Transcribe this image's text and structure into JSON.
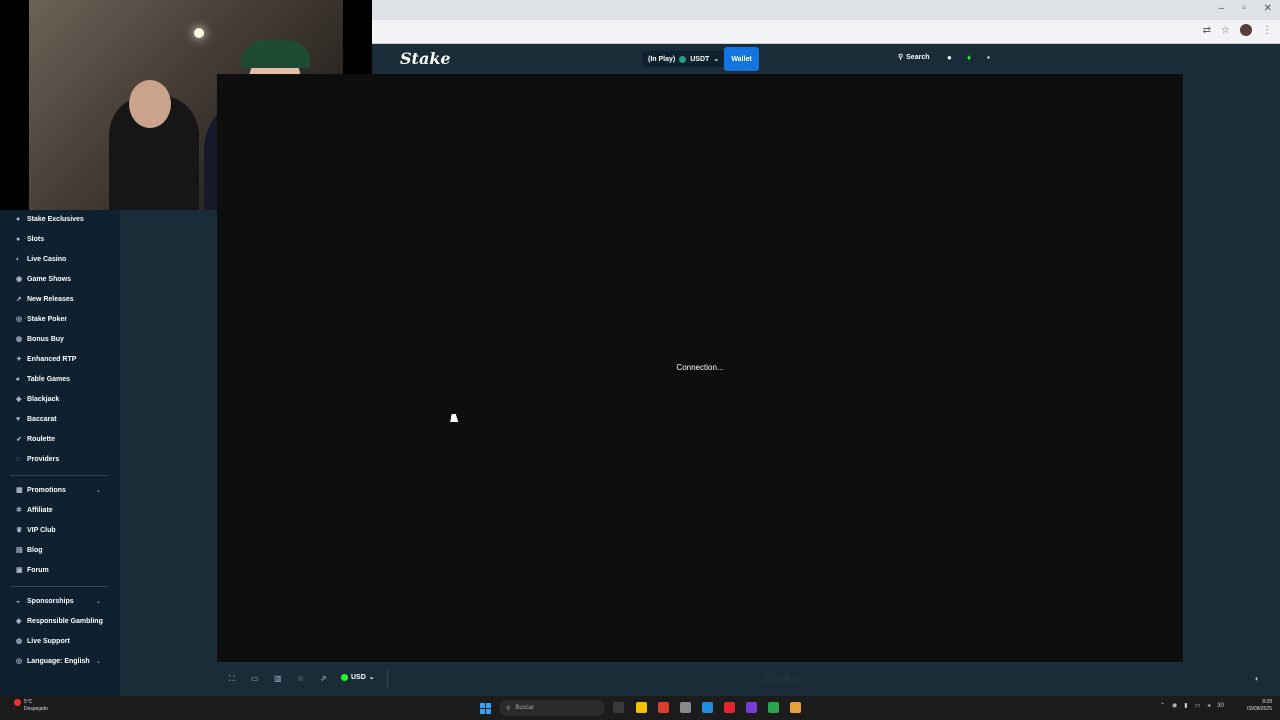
{
  "browser": {
    "window_controls": [
      "–",
      "▫",
      "✕"
    ],
    "address_icons": [
      "translate-icon",
      "star-icon",
      "profile-avatar",
      "menu-icon"
    ]
  },
  "header": {
    "logo": "Stake",
    "balance_label": "(In Play)",
    "balance_currency": "USDT",
    "wallet_label": "Wallet",
    "search_label": "Search"
  },
  "sidebar": {
    "casino_items": [
      {
        "label": "Stake Exclusives",
        "icon": "●"
      },
      {
        "label": "Slots",
        "icon": "●"
      },
      {
        "label": "Live Casino",
        "icon": "◐"
      },
      {
        "label": "Game Shows",
        "icon": "◉"
      },
      {
        "label": "New Releases",
        "icon": "➚"
      },
      {
        "label": "Stake Poker",
        "icon": "◎"
      },
      {
        "label": "Bonus Buy",
        "icon": "◍"
      },
      {
        "label": "Enhanced RTP",
        "icon": "✦"
      },
      {
        "label": "Table Games",
        "icon": "♠"
      },
      {
        "label": "Blackjack",
        "icon": "◈"
      },
      {
        "label": "Baccarat",
        "icon": "♥"
      },
      {
        "label": "Roulette",
        "icon": "➶"
      },
      {
        "label": "Providers",
        "icon": "◌"
      }
    ],
    "other_items": [
      {
        "label": "Promotions",
        "icon": "▦",
        "chevron": true
      },
      {
        "label": "Affiliate",
        "icon": "✲",
        "chevron": false
      },
      {
        "label": "VIP Club",
        "icon": "♛",
        "chevron": false
      },
      {
        "label": "Blog",
        "icon": "▤",
        "chevron": false
      },
      {
        "label": "Forum",
        "icon": "▣",
        "chevron": false
      }
    ],
    "bottom_items": [
      {
        "label": "Sponsorships",
        "icon": "◒",
        "chevron": true
      },
      {
        "label": "Responsible Gambling",
        "icon": "◈",
        "chevron": false
      },
      {
        "label": "Live Support",
        "icon": "◍",
        "chevron": false
      },
      {
        "label": "Language: English",
        "icon": "◎",
        "chevron": true
      }
    ]
  },
  "main": {
    "status_text": "Connection...",
    "watermark": "Stake"
  },
  "game_bar": {
    "currency": "USD"
  },
  "taskbar": {
    "weather_temp": "5°C",
    "weather_desc": "Despejado",
    "search_placeholder": "Buscar",
    "tray_volume": "30",
    "time": "8:28",
    "date": "03/08/2025"
  },
  "colors": {
    "sidebar_bg": "#0f212e",
    "panel_bg": "#1a2c38",
    "wallet_blue": "#1475e1",
    "game_bg": "#0e0e0e"
  }
}
